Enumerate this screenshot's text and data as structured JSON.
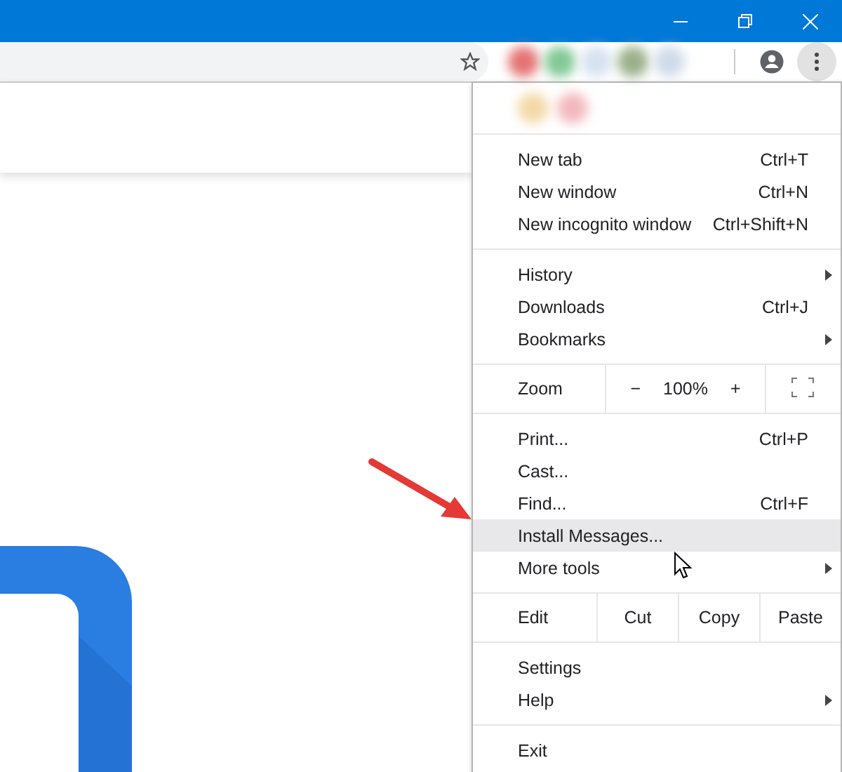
{
  "menu": {
    "sections": [
      {
        "kind": "list",
        "items": [
          {
            "label": "New tab",
            "shortcut": "Ctrl+T",
            "submenu": false,
            "selected": false
          },
          {
            "label": "New window",
            "shortcut": "Ctrl+N",
            "submenu": false,
            "selected": false
          },
          {
            "label": "New incognito window",
            "shortcut": "Ctrl+Shift+N",
            "submenu": false,
            "selected": false
          }
        ]
      },
      {
        "kind": "list",
        "items": [
          {
            "label": "History",
            "submenu": true,
            "selected": false
          },
          {
            "label": "Downloads",
            "shortcut": "Ctrl+J",
            "submenu": false,
            "selected": false
          },
          {
            "label": "Bookmarks",
            "submenu": true,
            "selected": false
          }
        ]
      },
      {
        "kind": "zoom",
        "label": "Zoom",
        "minus": "−",
        "value": "100%",
        "plus": "+"
      },
      {
        "kind": "list",
        "items": [
          {
            "label": "Print...",
            "shortcut": "Ctrl+P",
            "submenu": false,
            "selected": false
          },
          {
            "label": "Cast...",
            "submenu": false,
            "selected": false
          },
          {
            "label": "Find...",
            "shortcut": "Ctrl+F",
            "submenu": false,
            "selected": false
          },
          {
            "label": "Install Messages...",
            "submenu": false,
            "selected": true
          },
          {
            "label": "More tools",
            "submenu": true,
            "selected": false
          }
        ]
      },
      {
        "kind": "edit",
        "label": "Edit",
        "buttons": [
          "Cut",
          "Copy",
          "Paste"
        ]
      },
      {
        "kind": "list",
        "items": [
          {
            "label": "Settings",
            "submenu": false,
            "selected": false
          },
          {
            "label": "Help",
            "submenu": true,
            "selected": false
          }
        ]
      },
      {
        "kind": "list",
        "items": [
          {
            "label": "Exit",
            "submenu": false,
            "selected": false
          }
        ]
      }
    ]
  }
}
